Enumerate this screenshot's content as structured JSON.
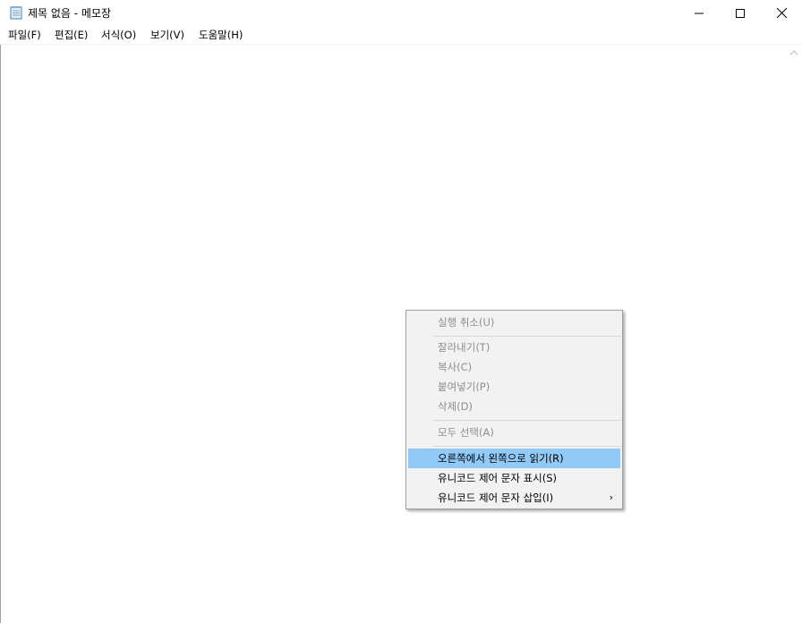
{
  "window": {
    "title": "제목 없음 - 메모장",
    "controls": {
      "minimize_icon": "minimize-icon",
      "maximize_icon": "maximize-icon",
      "close_icon": "close-icon"
    }
  },
  "menubar": {
    "items": [
      {
        "label": "파일(F)"
      },
      {
        "label": "편집(E)"
      },
      {
        "label": "서식(O)"
      },
      {
        "label": "보기(V)"
      },
      {
        "label": "도움말(H)"
      }
    ]
  },
  "editor": {
    "content": ""
  },
  "context_menu": {
    "items": [
      {
        "label": "실행 취소(U)",
        "enabled": false
      },
      {
        "label": "잘라내기(T)",
        "enabled": false
      },
      {
        "label": "복사(C)",
        "enabled": false
      },
      {
        "label": "붙여넣기(P)",
        "enabled": false
      },
      {
        "label": "삭제(D)",
        "enabled": false
      },
      {
        "label": "모두 선택(A)",
        "enabled": false
      },
      {
        "label": "오른쪽에서 왼쪽으로 읽기(R)",
        "enabled": true,
        "highlighted": true
      },
      {
        "label": "유니코드 제어 문자 표시(S)",
        "enabled": true
      },
      {
        "label": "유니코드 제어 문자 삽입(I)",
        "enabled": true,
        "submenu_arrow": "›"
      }
    ]
  },
  "colors": {
    "highlight": "#91c9f7",
    "menu_background": "#f2f2f2",
    "disabled_text": "#8d8d8d"
  }
}
